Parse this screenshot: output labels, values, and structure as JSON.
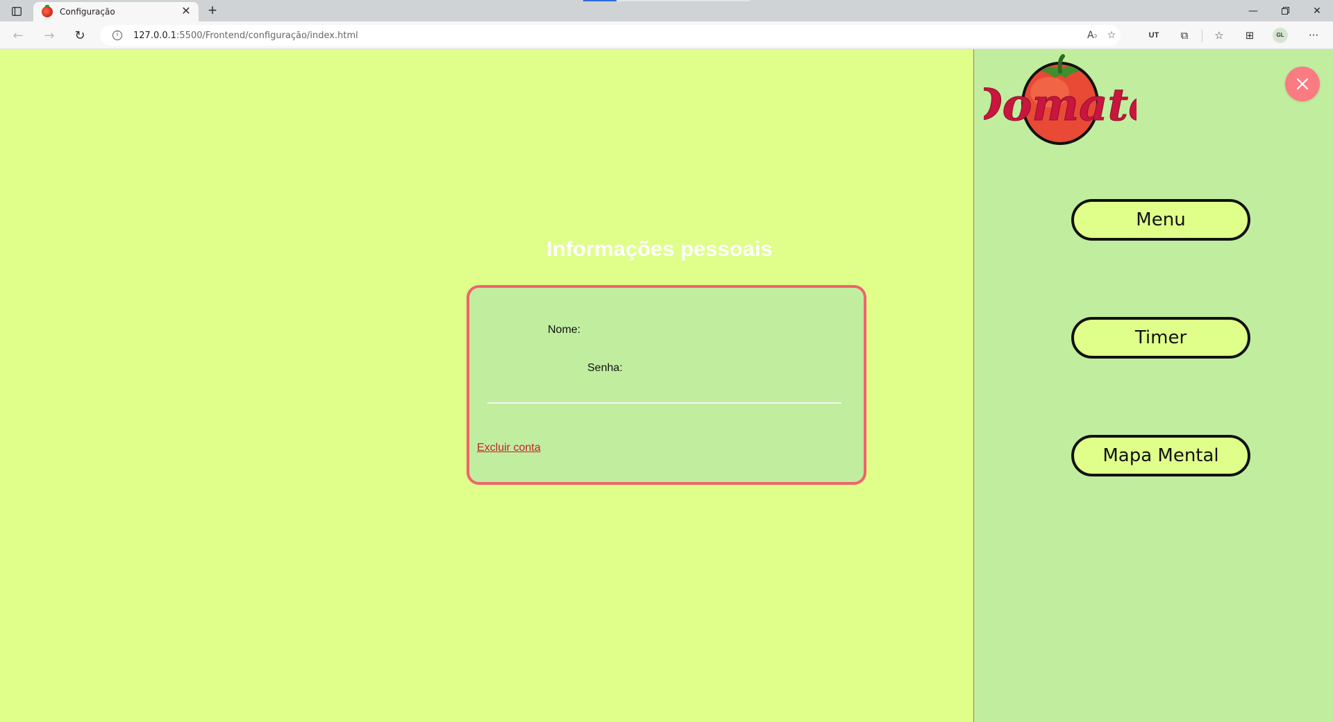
{
  "browser": {
    "tab_title": "Configuração",
    "url_host": "127.0.0.1",
    "url_rest": ":5500/Frontend/configuração/index.html",
    "profile_initials": "GL",
    "icons": {
      "tab_actions": "tab-actions-icon",
      "favicon": "tomato-icon",
      "back": "back-arrow-icon",
      "forward": "forward-arrow-icon",
      "refresh": "refresh-icon",
      "site_info": "info-icon",
      "read_aloud": "read-aloud-icon",
      "favorite_add": "add-favorite-icon",
      "translate": "translate-icon",
      "extensions": "extensions-icon",
      "favorites": "favorites-icon",
      "collections": "collections-icon",
      "more": "more-icon"
    }
  },
  "page": {
    "section_title": "Informações pessoais",
    "fields": {
      "name_label": "Nome:",
      "password_label": "Senha:"
    },
    "delete_account": "Excluir conta"
  },
  "sidebar": {
    "logo_text": "Domate",
    "nav": [
      {
        "label": "Menu"
      },
      {
        "label": "Timer"
      },
      {
        "label": "Mapa Mental"
      }
    ]
  },
  "colors": {
    "page_background": "#dfff8a",
    "sidebar_background": "#c1ed9f",
    "card_border": "#f0636c",
    "close_button": "#fb7b82",
    "logo_red": "#c8163f",
    "link_red": "#c0222e"
  }
}
